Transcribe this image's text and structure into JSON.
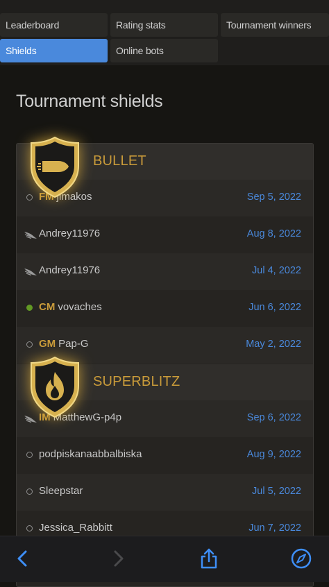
{
  "tabs": {
    "leaderboard": "Leaderboard",
    "rating_stats": "Rating stats",
    "tournament_winners": "Tournament winners",
    "shields": "Shields",
    "online_bots": "Online bots"
  },
  "page_title": "Tournament shields",
  "sections": [
    {
      "title": "BULLET",
      "icon": "bullet-icon",
      "rows": [
        {
          "status": "offline",
          "title": "FM",
          "name": "jimakos",
          "date": "Sep 5, 2022"
        },
        {
          "status": "bot",
          "title": "",
          "name": "Andrey11976",
          "date": "Aug 8, 2022"
        },
        {
          "status": "bot",
          "title": "",
          "name": "Andrey11976",
          "date": "Jul 4, 2022"
        },
        {
          "status": "online",
          "title": "CM",
          "name": "vovaches",
          "date": "Jun 6, 2022"
        },
        {
          "status": "offline",
          "title": "GM",
          "name": "Pap-G",
          "date": "May 2, 2022"
        }
      ]
    },
    {
      "title": "SUPERBLITZ",
      "icon": "flame-icon",
      "rows": [
        {
          "status": "bot",
          "title": "IM",
          "name": "MatthewG-p4p",
          "date": "Sep 6, 2022"
        },
        {
          "status": "offline",
          "title": "",
          "name": "podpiskanaabbalbiska",
          "date": "Aug 9, 2022"
        },
        {
          "status": "offline",
          "title": "",
          "name": "Sleepstar",
          "date": "Jul 5, 2022"
        },
        {
          "status": "offline",
          "title": "",
          "name": "Jessica_Rabbitt",
          "date": "Jun 7, 2022"
        }
      ]
    }
  ],
  "colors": {
    "accent": "#4a89dc",
    "gold": "#c99b3a",
    "online": "#629924",
    "background": "#161512"
  },
  "toolbar": {
    "back_icon": "chevron-left-icon",
    "forward_icon": "chevron-right-icon",
    "share_icon": "share-icon",
    "browser_icon": "compass-icon"
  }
}
